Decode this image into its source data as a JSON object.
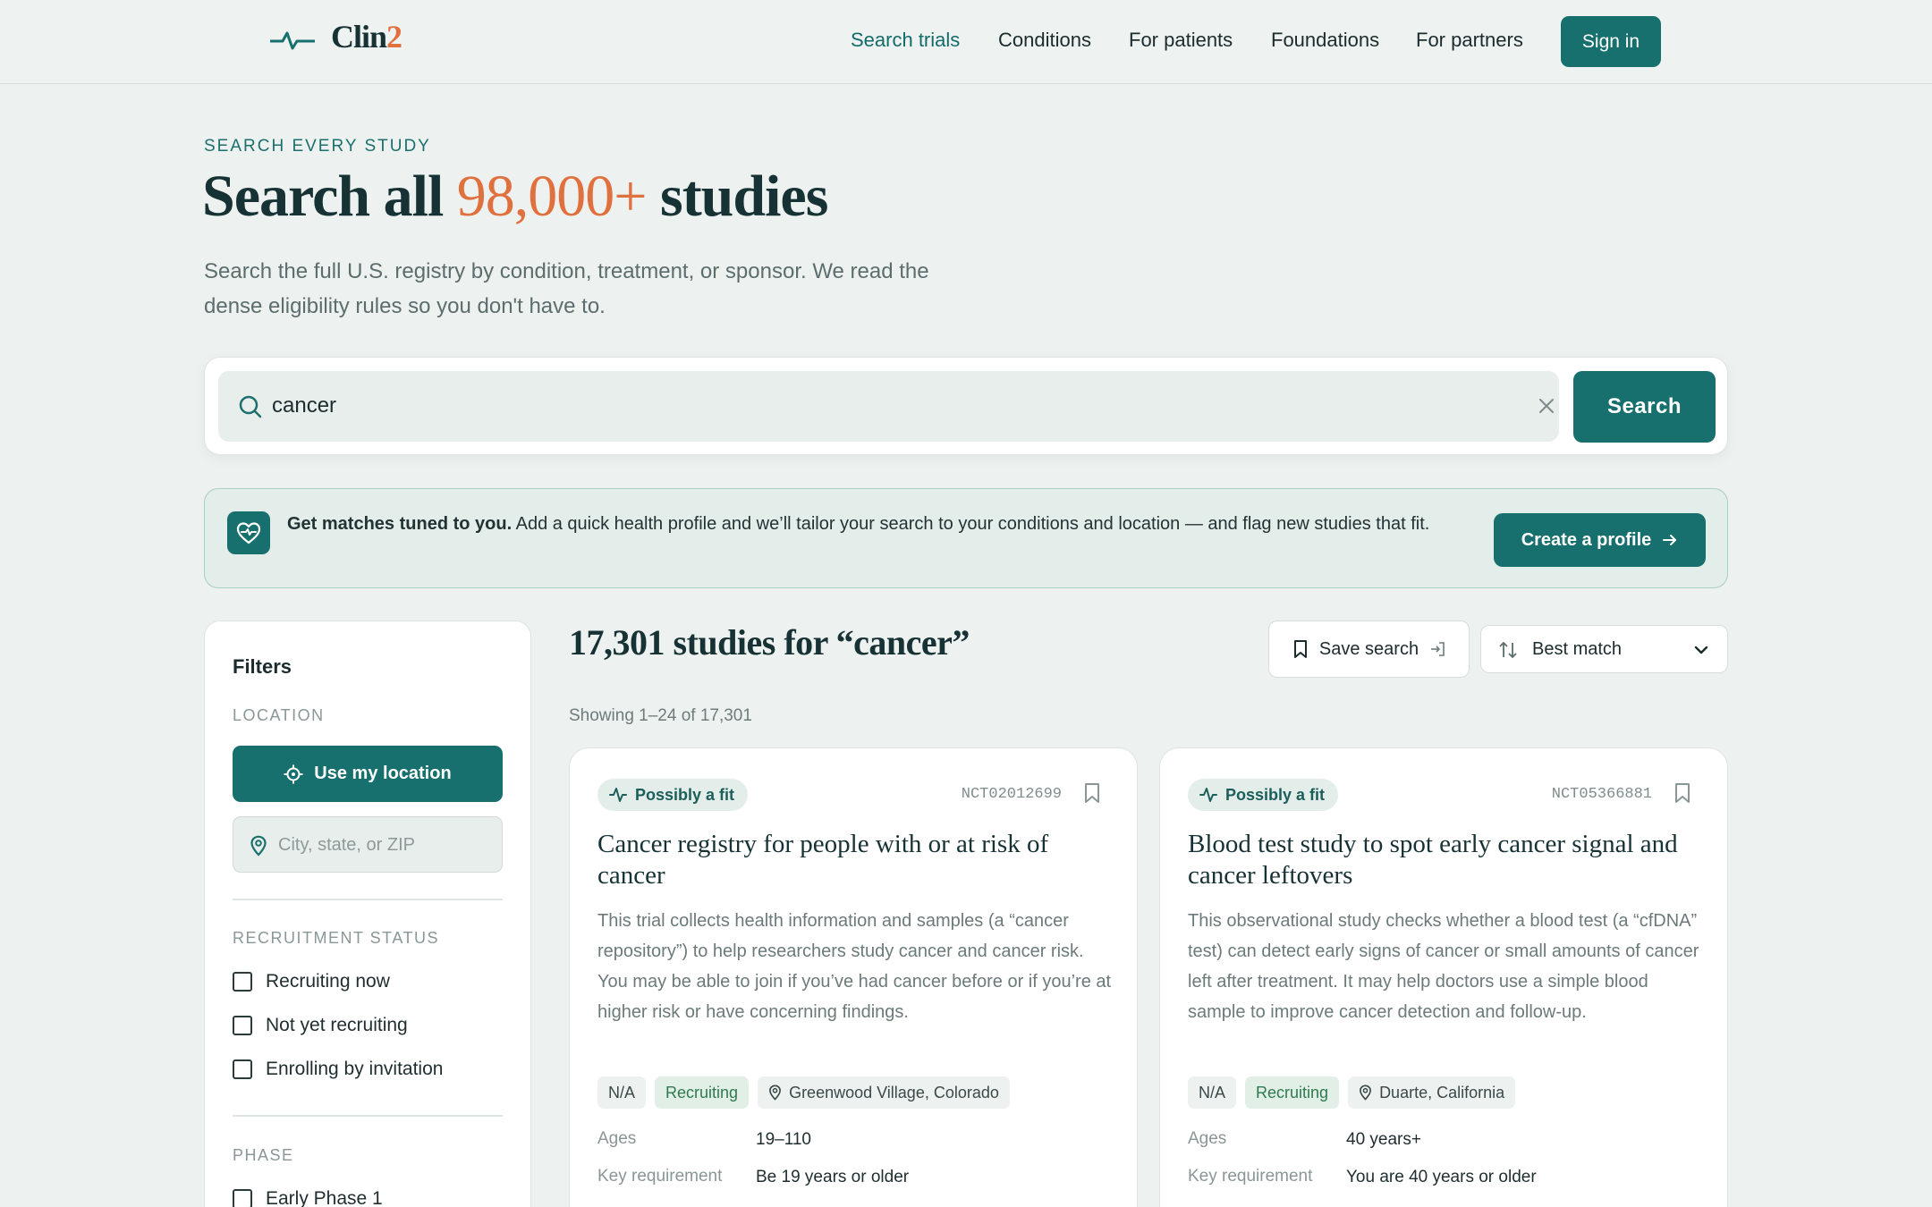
{
  "header": {
    "logo_text": "Clin",
    "logo_num": "2",
    "nav": [
      "Search trials",
      "Conditions",
      "For patients",
      "Foundations",
      "For partners"
    ],
    "signin": "Sign in",
    "accent_color": "#17706d",
    "brand_orange": "#e0703d"
  },
  "hero": {
    "eyebrow": "SEARCH EVERY STUDY",
    "title_prefix": "Search all",
    "title_number": "98,000+",
    "title_suffix": "studies",
    "subtitle": "Search the full U.S. registry by condition, treatment, or sponsor. We read the dense eligibility rules so you don't have to."
  },
  "search": {
    "value": "cancer",
    "button": "Search"
  },
  "banner": {
    "bold": "Get matches tuned to you.",
    "text": " Add a quick health profile and we’ll tailor your search to your conditions and location — and flag new studies that fit.",
    "button": "Create a profile"
  },
  "filters": {
    "title": "Filters",
    "location_label": "LOCATION",
    "use_location": "Use my location",
    "location_placeholder": "City, state, or ZIP",
    "status_label": "RECRUITMENT STATUS",
    "status_options": [
      "Recruiting now",
      "Not yet recruiting",
      "Enrolling by invitation"
    ],
    "phase_label": "PHASE",
    "phase_options": [
      "Early Phase 1"
    ]
  },
  "results": {
    "title": "17,301 studies for “cancer”",
    "showing": "Showing 1–24 of 17,301",
    "save_search": "Save search",
    "sort": "Best match",
    "cards": [
      {
        "badge": "Possibly a fit",
        "nct": "NCT02012699",
        "title": "Cancer registry for people with or at risk of cancer",
        "description": "This trial collects health information and samples (a “cancer repository”) to help researchers study cancer and cancer risk. You may be able to join if you’ve had cancer before or if you’re at higher risk or have concerning findings.",
        "phase": "N/A",
        "status": "Recruiting",
        "location": "Greenwood Village, Colorado",
        "ages_label": "Ages",
        "ages": "19–110",
        "req_label": "Key requirement",
        "requirement": "Be 19 years or older"
      },
      {
        "badge": "Possibly a fit",
        "nct": "NCT05366881",
        "title": "Blood test study to spot early cancer signal and cancer leftovers",
        "description": "This observational study checks whether a blood test (a “cfDNA” test) can detect early signs of cancer or small amounts of cancer left after treatment. It may help doctors use a simple blood sample to improve cancer detection and follow-up.",
        "phase": "N/A",
        "status": "Recruiting",
        "location": "Duarte, California",
        "ages_label": "Ages",
        "ages": "40 years+",
        "req_label": "Key requirement",
        "requirement": "You are 40 years or older"
      }
    ]
  }
}
